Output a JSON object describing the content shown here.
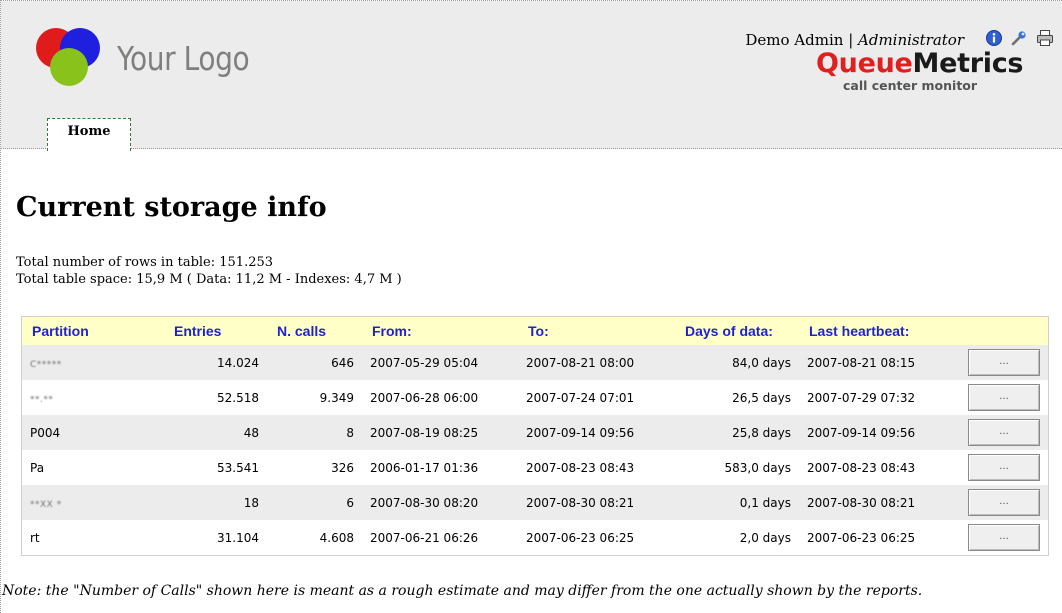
{
  "header": {
    "logo_text": "Your Logo",
    "user_name": "Demo Admin",
    "separator": " | ",
    "user_role": "Administrator",
    "brand_part1": "Queue",
    "brand_part2": "Metrics",
    "brand_tagline": "call center monitor",
    "icons": [
      "info-icon",
      "tools-icon",
      "printer-icon"
    ],
    "brand_colors": {
      "queue": "#e02020",
      "metrics": "#1a1a1a",
      "logo_red": "#e01b1b",
      "logo_blue": "#1f1fe0",
      "logo_green": "#88c21a"
    }
  },
  "nav": {
    "tabs": [
      {
        "label": "Home",
        "active": true
      }
    ]
  },
  "main": {
    "title": "Current storage info",
    "rows_line": "Total number of rows in table: 151.253",
    "space_line": "Total table space: 15,9 M ( Data: 11,2 M - Indexes: 4,7 M )",
    "table": {
      "headers": [
        "Partition",
        "Entries",
        "N. calls",
        "From:",
        "To:",
        "Days of data:",
        "Last heartbeat:",
        ""
      ],
      "rows": [
        {
          "partition": "C*****",
          "entries": "14.024",
          "ncalls": "646",
          "from": "2007-05-29 05:04",
          "to": "2007-08-21 08:00",
          "days": "84,0 days",
          "heartbeat": "2007-08-21 08:15",
          "action": "...",
          "partition_obscured": true
        },
        {
          "partition": "**.**",
          "entries": "52.518",
          "ncalls": "9.349",
          "from": "2007-06-28 06:00",
          "to": "2007-07-24 07:01",
          "days": "26,5 days",
          "heartbeat": "2007-07-29 07:32",
          "action": "...",
          "partition_obscured": true
        },
        {
          "partition": "P004",
          "entries": "48",
          "ncalls": "8",
          "from": "2007-08-19 08:25",
          "to": "2007-09-14 09:56",
          "days": "25,8 days",
          "heartbeat": "2007-09-14 09:56",
          "action": "...",
          "partition_obscured": false
        },
        {
          "partition": "Pa",
          "entries": "53.541",
          "ncalls": "326",
          "from": "2006-01-17 01:36",
          "to": "2007-08-23 08:43",
          "days": "583,0 days",
          "heartbeat": "2007-08-23 08:43",
          "action": "...",
          "partition_obscured": false
        },
        {
          "partition": "**XX *",
          "entries": "18",
          "ncalls": "6",
          "from": "2007-08-30 08:20",
          "to": "2007-08-30 08:21",
          "days": "0,1 days",
          "heartbeat": "2007-08-30 08:21",
          "action": "...",
          "partition_obscured": true
        },
        {
          "partition": "rt",
          "entries": "31.104",
          "ncalls": "4.608",
          "from": "2007-06-21 06:26",
          "to": "2007-06-23 06:25",
          "days": "2,0 days",
          "heartbeat": "2007-06-23 06:25",
          "action": "...",
          "partition_obscured": false
        }
      ]
    },
    "note": "Note: the \"Number of Calls\" shown here is meant as a rough estimate and may differ from the one actually shown by the reports."
  }
}
